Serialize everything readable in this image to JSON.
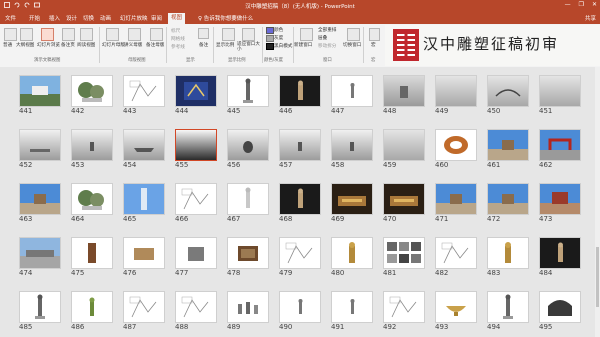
{
  "window": {
    "title": "汉中雕塑招稿（8）(无人机版) - PowerPoint",
    "controls": [
      "—",
      "❐",
      "✕"
    ]
  },
  "tabs": [
    "文件",
    "开始",
    "插入",
    "设计",
    "切换",
    "动画",
    "幻灯片放映",
    "审阅",
    "视图"
  ],
  "active_tab": "视图",
  "tell_me": "♀ 告诉我你想要做什么",
  "share": "共享",
  "ribbon": {
    "buttons": [
      "普通",
      "大纲视图",
      "幻灯片浏览",
      "备注页",
      "阅读视图",
      "幻灯片母版",
      "讲义母版",
      "备注母版",
      "标尺",
      "网格线",
      "参考线",
      "备注",
      "显示比例",
      "适应窗口大小",
      "颜色",
      "灰度",
      "黑白模式",
      "新建窗口",
      "全部重排",
      "层叠",
      "移动拆分",
      "切换窗口",
      "宏"
    ],
    "groups": [
      "演示文稿视图",
      "母版视图",
      "显示",
      "显示比例",
      "颜色/灰度",
      "窗口",
      "宏"
    ]
  },
  "banner": {
    "text": "汉中雕塑征稿初审",
    "color": "#c0272d"
  },
  "slides": [
    {
      "n": "441",
      "art": "landscape-blue"
    },
    {
      "n": "442",
      "art": "trees"
    },
    {
      "n": "443",
      "art": "sketch"
    },
    {
      "n": "444",
      "art": "dark-blue-art"
    },
    {
      "n": "445",
      "art": "figure"
    },
    {
      "n": "446",
      "art": "dark-figure"
    },
    {
      "n": "447",
      "art": "small-figure"
    },
    {
      "n": "448",
      "art": "gray-sculpture"
    },
    {
      "n": "449",
      "art": "gray-plain"
    },
    {
      "n": "450",
      "art": "gray-arch"
    },
    {
      "n": "451",
      "art": "gray-plain"
    },
    {
      "n": "452",
      "art": "gray-bottom"
    },
    {
      "n": "453",
      "art": "gray-small"
    },
    {
      "n": "454",
      "art": "gray-boat"
    },
    {
      "n": "455",
      "art": "gray-dark-bottom"
    },
    {
      "n": "456",
      "art": "gray-vase"
    },
    {
      "n": "457",
      "art": "gray-small"
    },
    {
      "n": "458",
      "art": "gray-small"
    },
    {
      "n": "459",
      "art": "gray-plain"
    },
    {
      "n": "460",
      "art": "orange-shape"
    },
    {
      "n": "461",
      "art": "plaza-blue"
    },
    {
      "n": "462",
      "art": "red-gate"
    },
    {
      "n": "463",
      "art": "plaza-blue"
    },
    {
      "n": "464",
      "art": "trees"
    },
    {
      "n": "465",
      "art": "blue-tower"
    },
    {
      "n": "466",
      "art": "sketch"
    },
    {
      "n": "467",
      "art": "white-figure"
    },
    {
      "n": "468",
      "art": "dark-figure"
    },
    {
      "n": "469",
      "art": "night-gold"
    },
    {
      "n": "470",
      "art": "night-gold"
    },
    {
      "n": "471",
      "art": "plaza-blue"
    },
    {
      "n": "472",
      "art": "plaza-blue"
    },
    {
      "n": "473",
      "art": "plaza-red"
    },
    {
      "n": "474",
      "art": "plaza-gray"
    },
    {
      "n": "475",
      "art": "brown-pillar"
    },
    {
      "n": "476",
      "art": "brown-object"
    },
    {
      "n": "477",
      "art": "gray-object"
    },
    {
      "n": "478",
      "art": "brown-box"
    },
    {
      "n": "479",
      "art": "sketch"
    },
    {
      "n": "480",
      "art": "gold-figure"
    },
    {
      "n": "481",
      "art": "collage"
    },
    {
      "n": "482",
      "art": "sketch"
    },
    {
      "n": "483",
      "art": "gold-figure"
    },
    {
      "n": "484",
      "art": "dark-figure"
    },
    {
      "n": "485",
      "art": "figure"
    },
    {
      "n": "486",
      "art": "green-figure"
    },
    {
      "n": "487",
      "art": "sketch"
    },
    {
      "n": "488",
      "art": "sketch"
    },
    {
      "n": "489",
      "art": "group-figures"
    },
    {
      "n": "490",
      "art": "small-figure"
    },
    {
      "n": "491",
      "art": "small-figure"
    },
    {
      "n": "492",
      "art": "sketch"
    },
    {
      "n": "493",
      "art": "gold-bowl"
    },
    {
      "n": "494",
      "art": "figure"
    },
    {
      "n": "495",
      "art": "dark-arch"
    }
  ],
  "selected_slide": "455"
}
